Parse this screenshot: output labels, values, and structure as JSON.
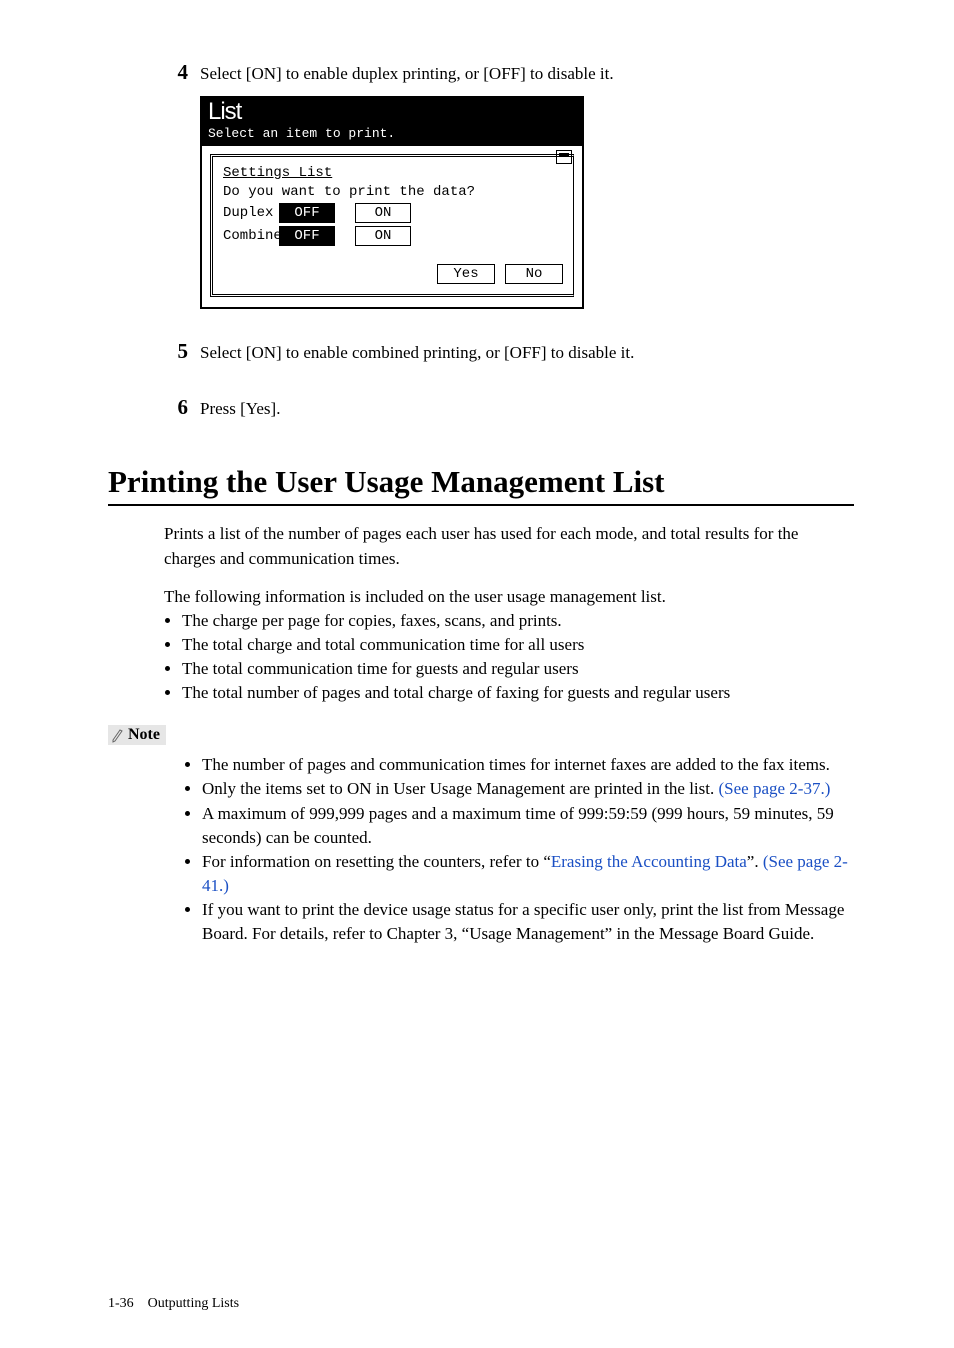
{
  "steps": {
    "s4": {
      "num": "4",
      "text": "Select [ON] to enable duplex printing, or [OFF] to disable it."
    },
    "s5": {
      "num": "5",
      "text": "Select [ON] to enable combined printing, or [OFF] to disable it."
    },
    "s6": {
      "num": "6",
      "text": "Press [Yes]."
    }
  },
  "lcd": {
    "title": "List",
    "subtitle": "Select an item to print.",
    "heading": "Settings List",
    "question": "Do you want to print the data?",
    "row1": {
      "label": "Duplex",
      "off": "OFF",
      "on": "ON"
    },
    "row2": {
      "label": "Combine",
      "off": "OFF",
      "on": "ON"
    },
    "yes": "Yes",
    "no": "No"
  },
  "section": {
    "title": "Printing the User Usage Management List",
    "intro": "Prints a list of the number of pages each user has used for each mode, and total results for the charges and communication times.",
    "lead": "The following information is included on the user usage management list.",
    "bullets": [
      "The charge per page for copies, faxes, scans, and prints.",
      "The total charge and total communication time for all users",
      "The total communication time for guests and regular users",
      "The total number of pages and total charge of faxing for guests and regular users"
    ]
  },
  "note": {
    "label": "Note",
    "items": {
      "n1": "The number of pages and communication times for internet faxes are added to the fax items.",
      "n2a": "Only the items set to ON in User Usage Management are printed in the list. ",
      "n2b": "(See page 2-37.)",
      "n3": "A maximum of 999,999 pages and a maximum time of 999:59:59 (999 hours, 59 minutes, 59 seconds) can be counted.",
      "n4a": "For information on resetting the counters, refer to “",
      "n4b": "Erasing the Accounting Data",
      "n4c": "”. ",
      "n4d": "(See page 2-41.)",
      "n5": "If you want to print the device usage status for a specific user only, print the list from Message Board. For details, refer to Chapter 3, “Usage Management” in the Message Board Guide."
    }
  },
  "footer": {
    "pagenum": "1-36",
    "chapter": "Outputting Lists"
  }
}
